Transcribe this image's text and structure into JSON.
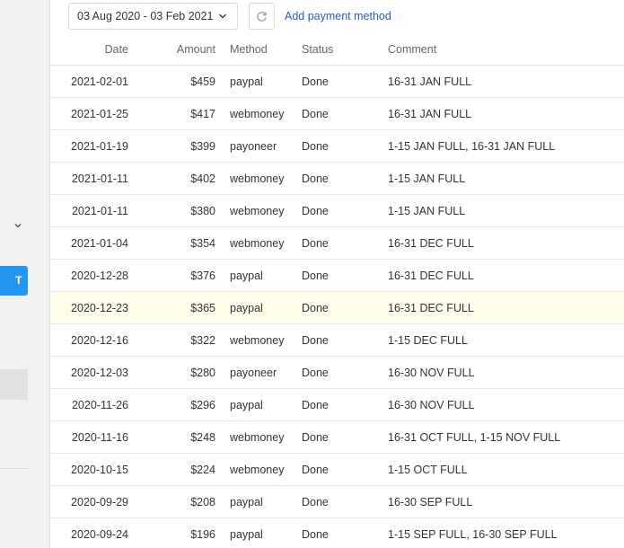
{
  "toolbar": {
    "date_range": "03 Aug 2020 - 03 Feb 2021",
    "refresh_icon": "refresh-icon",
    "add_payment_label": "Add payment method"
  },
  "sidebar": {
    "button_label": "T",
    "chevron_icon": "chevron-down-icon"
  },
  "table": {
    "columns": [
      "Date",
      "Amount",
      "Method",
      "Status",
      "Comment"
    ],
    "rows": [
      {
        "date": "2021-02-01",
        "amount": "$459",
        "method": "paypal",
        "status": "Done",
        "comment": "16-31 JAN FULL"
      },
      {
        "date": "2021-01-25",
        "amount": "$417",
        "method": "webmoney",
        "status": "Done",
        "comment": "16-31 JAN FULL"
      },
      {
        "date": "2021-01-19",
        "amount": "$399",
        "method": "payoneer",
        "status": "Done",
        "comment": "1-15 JAN FULL, 16-31 JAN FULL"
      },
      {
        "date": "2021-01-11",
        "amount": "$402",
        "method": "webmoney",
        "status": "Done",
        "comment": "1-15 JAN FULL"
      },
      {
        "date": "2021-01-11",
        "amount": "$380",
        "method": "webmoney",
        "status": "Done",
        "comment": "1-15 JAN FULL"
      },
      {
        "date": "2021-01-04",
        "amount": "$354",
        "method": "webmoney",
        "status": "Done",
        "comment": "16-31 DEC FULL"
      },
      {
        "date": "2020-12-28",
        "amount": "$376",
        "method": "paypal",
        "status": "Done",
        "comment": "16-31 DEC FULL"
      },
      {
        "date": "2020-12-23",
        "amount": "$365",
        "method": "paypal",
        "status": "Done",
        "comment": "16-31 DEC FULL"
      },
      {
        "date": "2020-12-16",
        "amount": "$322",
        "method": "webmoney",
        "status": "Done",
        "comment": "1-15 DEC FULL"
      },
      {
        "date": "2020-12-03",
        "amount": "$280",
        "method": "payoneer",
        "status": "Done",
        "comment": "16-30 NOV FULL"
      },
      {
        "date": "2020-11-26",
        "amount": "$296",
        "method": "paypal",
        "status": "Done",
        "comment": "16-30 NOV FULL"
      },
      {
        "date": "2020-11-16",
        "amount": "$248",
        "method": "webmoney",
        "status": "Done",
        "comment": "16-31 OCT FULL, 1-15 NOV FULL"
      },
      {
        "date": "2020-10-15",
        "amount": "$224",
        "method": "webmoney",
        "status": "Done",
        "comment": "1-15 OCT FULL"
      },
      {
        "date": "2020-09-29",
        "amount": "$208",
        "method": "paypal",
        "status": "Done",
        "comment": "16-30 SEP FULL"
      },
      {
        "date": "2020-09-24",
        "amount": "$196",
        "method": "paypal",
        "status": "Done",
        "comment": "1-15 SEP FULL, 16-30 SEP FULL"
      }
    ],
    "highlighted_row_index": 7
  },
  "colors": {
    "accent": "#2196f3",
    "link": "#2a5db0",
    "highlight_row": "#fdfde9"
  }
}
